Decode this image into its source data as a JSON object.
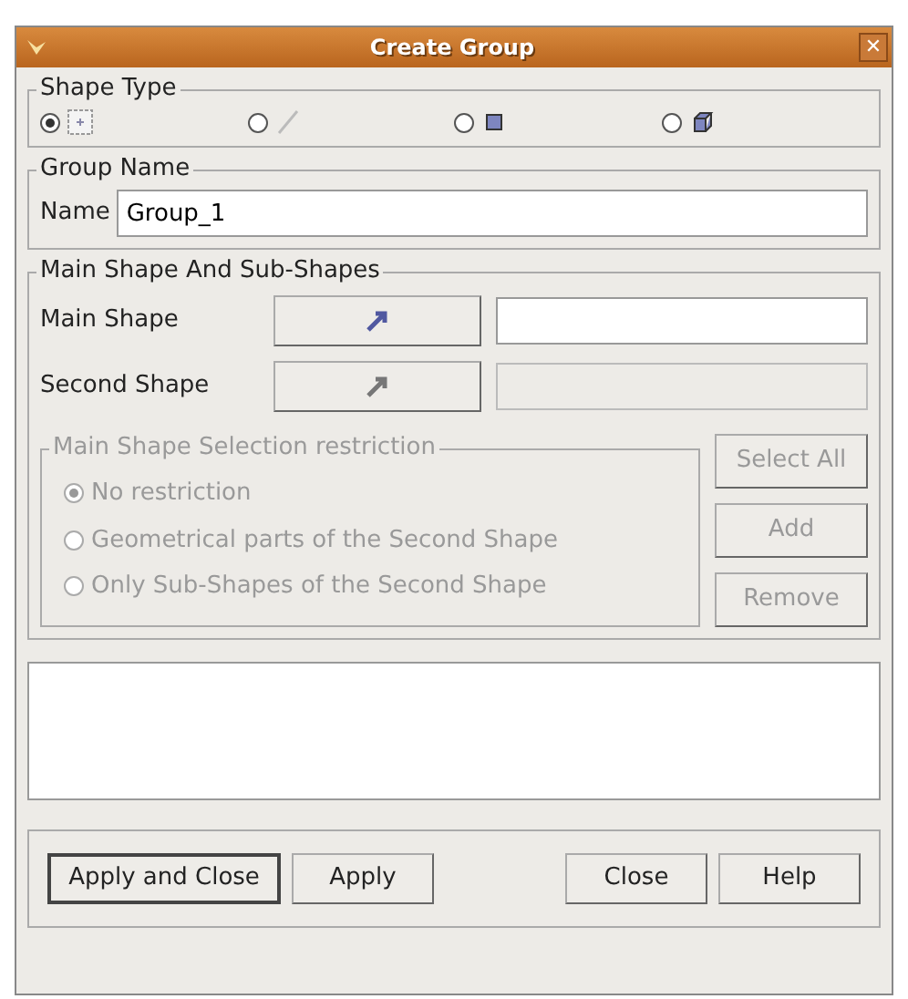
{
  "window": {
    "title": "Create Group",
    "close_glyph": "✕"
  },
  "shape_type": {
    "title": "Shape Type",
    "options": [
      {
        "kind": "point",
        "selected": true
      },
      {
        "kind": "line",
        "selected": false
      },
      {
        "kind": "face",
        "selected": false
      },
      {
        "kind": "solid",
        "selected": false
      }
    ]
  },
  "group_name": {
    "title": "Group Name",
    "label": "Name",
    "value": "Group_1"
  },
  "main_sub": {
    "title": "Main Shape And Sub-Shapes",
    "rows": [
      {
        "label": "Main Shape",
        "disabled": false
      },
      {
        "label": "Second Shape",
        "disabled": true
      }
    ],
    "restriction": {
      "title": "Main Shape Selection restriction",
      "disabled": true,
      "options": [
        {
          "label": "No restriction",
          "selected": true
        },
        {
          "label": "Geometrical parts of the Second Shape",
          "selected": false
        },
        {
          "label": "Only Sub-Shapes of the Second Shape",
          "selected": false
        }
      ]
    },
    "side_buttons": [
      {
        "label": "Select All",
        "disabled": true
      },
      {
        "label": "Add",
        "disabled": true
      },
      {
        "label": "Remove",
        "disabled": true
      }
    ]
  },
  "buttons": [
    {
      "label": "Apply and Close",
      "default": true
    },
    {
      "label": "Apply",
      "default": false
    },
    {
      "label": "Close",
      "default": false
    },
    {
      "label": "Help",
      "default": false
    }
  ]
}
